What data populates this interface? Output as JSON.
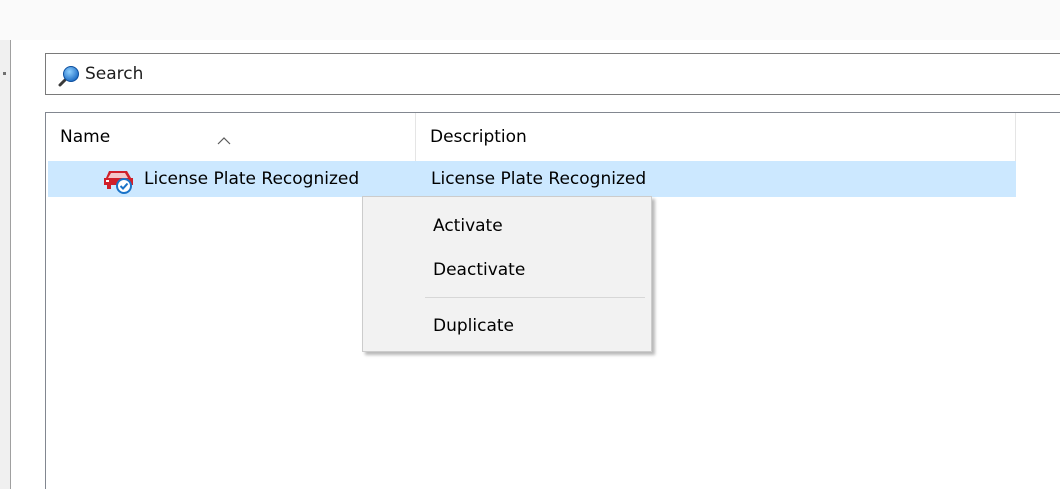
{
  "search": {
    "placeholder": "Search",
    "icon": "search-icon"
  },
  "list": {
    "columns": [
      {
        "label": "Name",
        "sorted": "ascending"
      },
      {
        "label": "Description"
      }
    ],
    "rows": [
      {
        "icon": "license-plate-car-icon",
        "name": "License Plate Recognized",
        "description": "License Plate Recognized",
        "selected": true
      }
    ]
  },
  "context_menu": {
    "items": [
      {
        "label": "Activate"
      },
      {
        "label": "Deactivate"
      },
      {
        "label": "Duplicate"
      }
    ]
  },
  "colors": {
    "selection": "#cce8ff",
    "menu_background": "#f2f2f2",
    "icon_red": "#d0202a",
    "icon_blue": "#1a73c8"
  }
}
